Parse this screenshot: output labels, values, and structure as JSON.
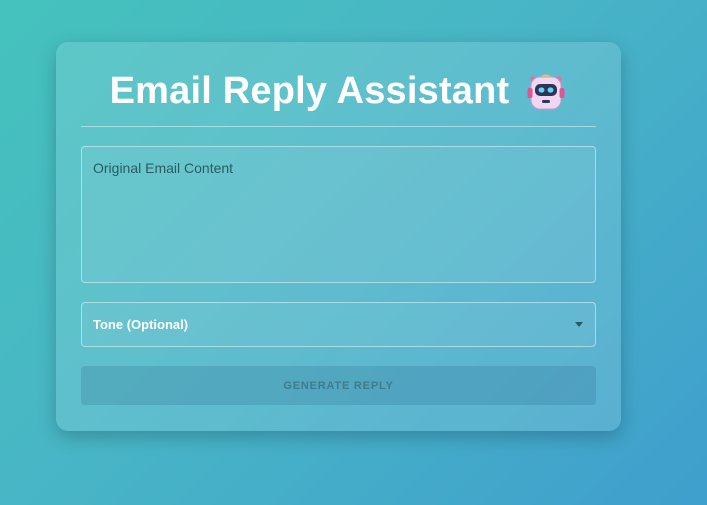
{
  "header": {
    "title": "Email Reply Assistant",
    "emoji_icon": "robot-icon"
  },
  "form": {
    "email_content": {
      "placeholder": "Original Email Content",
      "value": ""
    },
    "tone_select": {
      "label": "Tone (Optional)",
      "selected_value": "",
      "icon": "dropdown-arrow-icon"
    },
    "generate_button": {
      "label": "GENERATE REPLY",
      "enabled": false
    }
  },
  "colors": {
    "background_start": "#45c2bd",
    "background_end": "#3f9fcd",
    "title_text": "#ffffff",
    "button_text_disabled": "#3f7b88"
  }
}
